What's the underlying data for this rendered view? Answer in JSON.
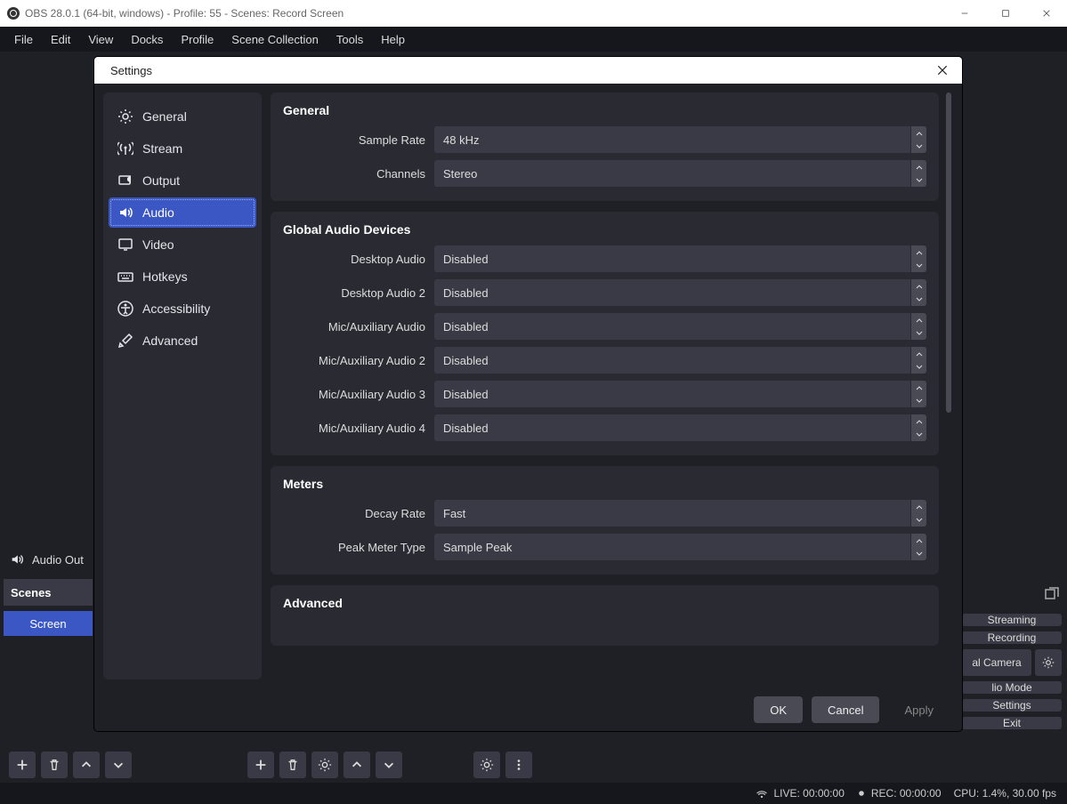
{
  "window": {
    "title": "OBS 28.0.1 (64-bit, windows) - Profile: 55 - Scenes: Record Screen"
  },
  "menubar": [
    "File",
    "Edit",
    "View",
    "Docks",
    "Profile",
    "Scene Collection",
    "Tools",
    "Help"
  ],
  "dialog": {
    "title": "Settings",
    "sidebar": [
      {
        "label": "General",
        "icon": "gear"
      },
      {
        "label": "Stream",
        "icon": "antenna"
      },
      {
        "label": "Output",
        "icon": "output"
      },
      {
        "label": "Audio",
        "icon": "speaker",
        "active": true
      },
      {
        "label": "Video",
        "icon": "monitor"
      },
      {
        "label": "Hotkeys",
        "icon": "keyboard"
      },
      {
        "label": "Accessibility",
        "icon": "accessibility"
      },
      {
        "label": "Advanced",
        "icon": "tools"
      }
    ],
    "sections": {
      "general": {
        "title": "General",
        "fields": [
          {
            "label": "Sample Rate",
            "value": "48 kHz"
          },
          {
            "label": "Channels",
            "value": "Stereo"
          }
        ]
      },
      "devices": {
        "title": "Global Audio Devices",
        "fields": [
          {
            "label": "Desktop Audio",
            "value": "Disabled"
          },
          {
            "label": "Desktop Audio 2",
            "value": "Disabled"
          },
          {
            "label": "Mic/Auxiliary Audio",
            "value": "Disabled"
          },
          {
            "label": "Mic/Auxiliary Audio 2",
            "value": "Disabled"
          },
          {
            "label": "Mic/Auxiliary Audio 3",
            "value": "Disabled"
          },
          {
            "label": "Mic/Auxiliary Audio 4",
            "value": "Disabled"
          }
        ]
      },
      "meters": {
        "title": "Meters",
        "fields": [
          {
            "label": "Decay Rate",
            "value": "Fast"
          },
          {
            "label": "Peak Meter Type",
            "value": "Sample Peak"
          }
        ]
      },
      "advanced": {
        "title": "Advanced"
      }
    },
    "buttons": {
      "ok": "OK",
      "cancel": "Cancel",
      "apply": "Apply"
    }
  },
  "behind": {
    "audio_out": "Audio Out",
    "scenes_title": "Scenes",
    "scene_item": "Screen",
    "right": {
      "streaming": "Streaming",
      "recording": "Recording",
      "camera": "al Camera",
      "studio": "lio Mode",
      "settings": "Settings",
      "exit": "Exit"
    }
  },
  "status": {
    "live": "LIVE: 00:00:00",
    "rec": "REC: 00:00:00",
    "cpu": "CPU: 1.4%, 30.00 fps"
  }
}
